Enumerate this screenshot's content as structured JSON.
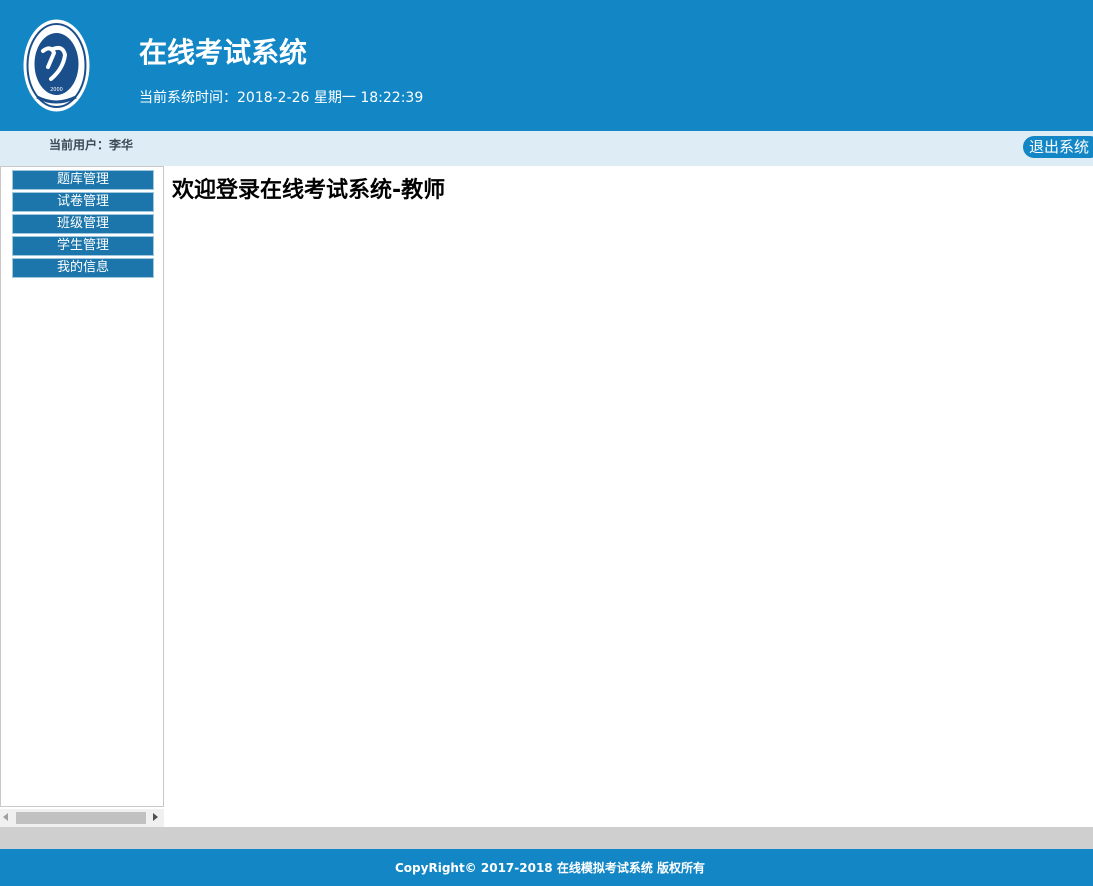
{
  "header": {
    "title": "在线考试系统",
    "system_time": "当前系统时间：2018-2-26 星期一 18:22:39",
    "logo_icon": "university-seal-logo",
    "logo_year": "2000",
    "accent_color": "#1387c6"
  },
  "userbar": {
    "current_user": "当前用户：李华",
    "logout_label": "退出系统"
  },
  "sidebar": {
    "items": [
      {
        "label": "题库管理"
      },
      {
        "label": "试卷管理"
      },
      {
        "label": "班级管理"
      },
      {
        "label": "学生管理"
      },
      {
        "label": "我的信息"
      }
    ]
  },
  "main": {
    "heading": "欢迎登录在线考试系统-教师"
  },
  "footer": {
    "copyright": "CopyRight© 2017-2018 在线模拟考试系统 版权所有"
  }
}
